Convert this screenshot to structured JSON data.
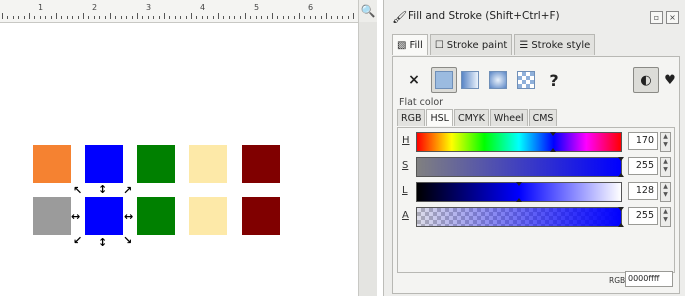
{
  "ruler": {
    "numbers": [
      "1",
      "2",
      "3",
      "4",
      "5",
      "6"
    ]
  },
  "canvas": {
    "swatch_colors": {
      "orange": "#f58231",
      "blue": "#0000ff",
      "green": "#008000",
      "cream": "#fde9a8",
      "maroon": "#800000",
      "gray": "#9b9b9b"
    },
    "selected_object": "blue square (bottom row)"
  },
  "dialog": {
    "title": "Fill and Stroke (Shift+Ctrl+F)",
    "tabs": [
      {
        "label": "Fill",
        "icon": "fill-icon",
        "active": true
      },
      {
        "label": "Stroke paint",
        "icon": "stroke-paint-icon",
        "active": false
      },
      {
        "label": "Stroke style",
        "icon": "stroke-style-icon",
        "active": false
      }
    ],
    "paint_modes": {
      "none": "×",
      "unset": "?",
      "selected": "flat color"
    },
    "fill_label": "Flat color",
    "color_tabs": [
      "RGB",
      "HSL",
      "CMYK",
      "Wheel",
      "CMS"
    ],
    "active_color_tab": "HSL",
    "channels": [
      {
        "label": "H",
        "value": "170",
        "fraction": 0.667
      },
      {
        "label": "S",
        "value": "255",
        "fraction": 1.0
      },
      {
        "label": "L",
        "value": "128",
        "fraction": 0.502
      },
      {
        "label": "A",
        "value": "255",
        "fraction": 1.0
      }
    ],
    "rgba_label": "RGBA:",
    "rgba_value": "0000ffff",
    "accent_color": "#0000ff"
  }
}
